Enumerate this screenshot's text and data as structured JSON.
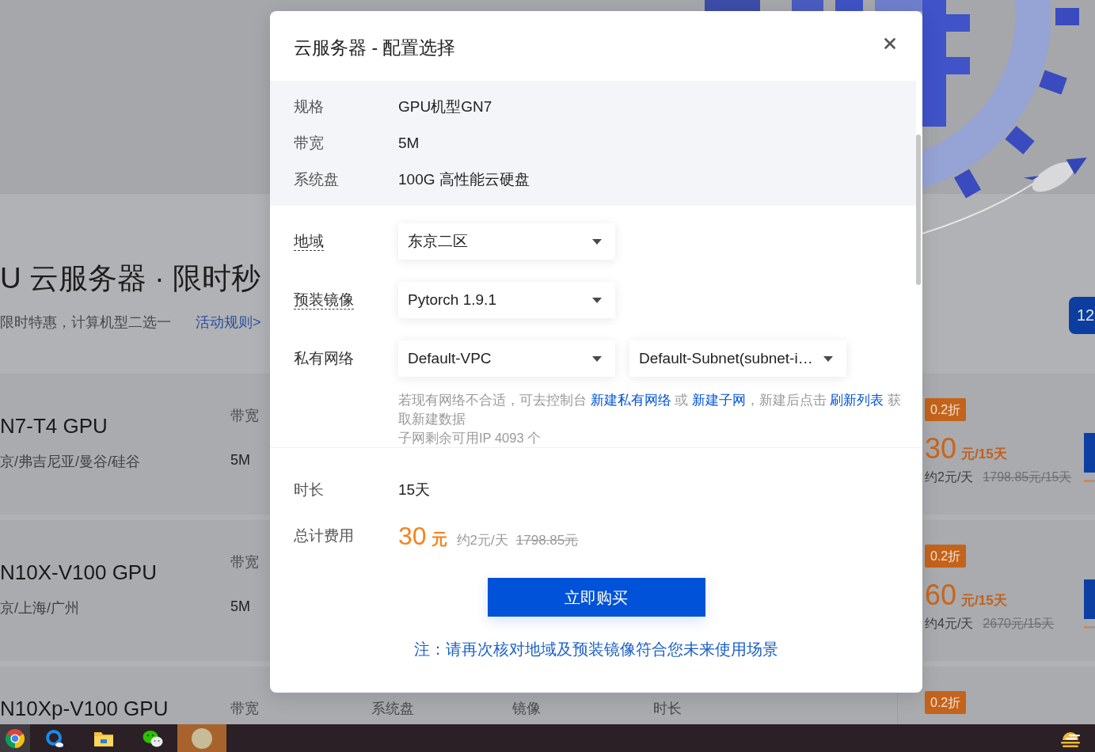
{
  "background": {
    "banner": {
      "heading": "U 云服务器 · 限时秒",
      "subtitle": "限时特惠，计算机型二选一",
      "rules_link": "活动规则>",
      "countdown": "12"
    },
    "products": [
      {
        "name": "N7-T4 GPU",
        "regions": "京/弗吉尼亚/曼谷/硅谷",
        "specs": [
          {
            "label": "带宽",
            "value": "5M"
          }
        ],
        "discount": "0.2折",
        "price": "30",
        "price_unit": "元/15天",
        "daily_price": "约2元/天",
        "original_price": "1798.85元/15天",
        "level": 0.75
      },
      {
        "name": "N10X-V100 GPU",
        "regions": "京/上海/广州",
        "specs": [
          {
            "label": "带宽",
            "value": "5M"
          }
        ],
        "discount": "0.2折",
        "price": "60",
        "price_unit": "元/15天",
        "daily_price": "约4元/天",
        "original_price": "2670元/15天",
        "level": 0.45
      },
      {
        "name": "N10Xp-V100 GPU",
        "specs": [
          {
            "label": "带宽"
          },
          {
            "label": "系统盘"
          },
          {
            "label": "镜像"
          },
          {
            "label": "时长"
          }
        ],
        "discount": "0.2折"
      }
    ]
  },
  "dialog": {
    "title": "云服务器 - 配置选择",
    "summary": [
      {
        "label": "规格",
        "value": "GPU机型GN7"
      },
      {
        "label": "带宽",
        "value": "5M"
      },
      {
        "label": "系统盘",
        "value": "100G 高性能云硬盘"
      }
    ],
    "fields": [
      {
        "label": "地域",
        "has_tooltip": true,
        "selects": [
          "东京二区"
        ]
      },
      {
        "label": "预装镜像",
        "has_tooltip": true,
        "selects": [
          "Pytorch 1.9.1"
        ]
      },
      {
        "label": "私有网络",
        "has_tooltip": false,
        "selects": [
          "Default-VPC",
          "Default-Subnet(subnet-i…"
        ]
      }
    ],
    "network_help": [
      {
        "kind": "text",
        "text": "若现有网络不合适，可去控制台 "
      },
      {
        "kind": "link",
        "text": "新建私有网络"
      },
      {
        "kind": "text",
        "text": " 或 "
      },
      {
        "kind": "link",
        "text": "新建子网"
      },
      {
        "kind": "text",
        "text": "，新建后点击 "
      },
      {
        "kind": "link",
        "text": "刷新列表"
      },
      {
        "kind": "text",
        "text": " 获取新建数据"
      }
    ],
    "subnet_note": "子网剩余可用IP 4093 个",
    "duration": {
      "label": "时长",
      "value": "15天"
    },
    "total": {
      "label": "总计费用",
      "amount": "30",
      "unit": "元",
      "daily": "约2元/天",
      "original": "1798.85元"
    },
    "buy_button": "立即购买",
    "note": "注：请再次核对地域及预装镜像符合您未来使用场景"
  },
  "taskbar": {
    "apps": [
      {
        "kind": "color-wheel",
        "selected": true,
        "flashing": false
      },
      {
        "kind": "ring",
        "selected": false,
        "flashing": false
      },
      {
        "kind": "folder",
        "selected": false,
        "flashing": false
      },
      {
        "kind": "chat-bubbles",
        "selected": false,
        "flashing": false
      },
      {
        "kind": "avatar",
        "selected": false,
        "flashing": true
      }
    ]
  }
}
